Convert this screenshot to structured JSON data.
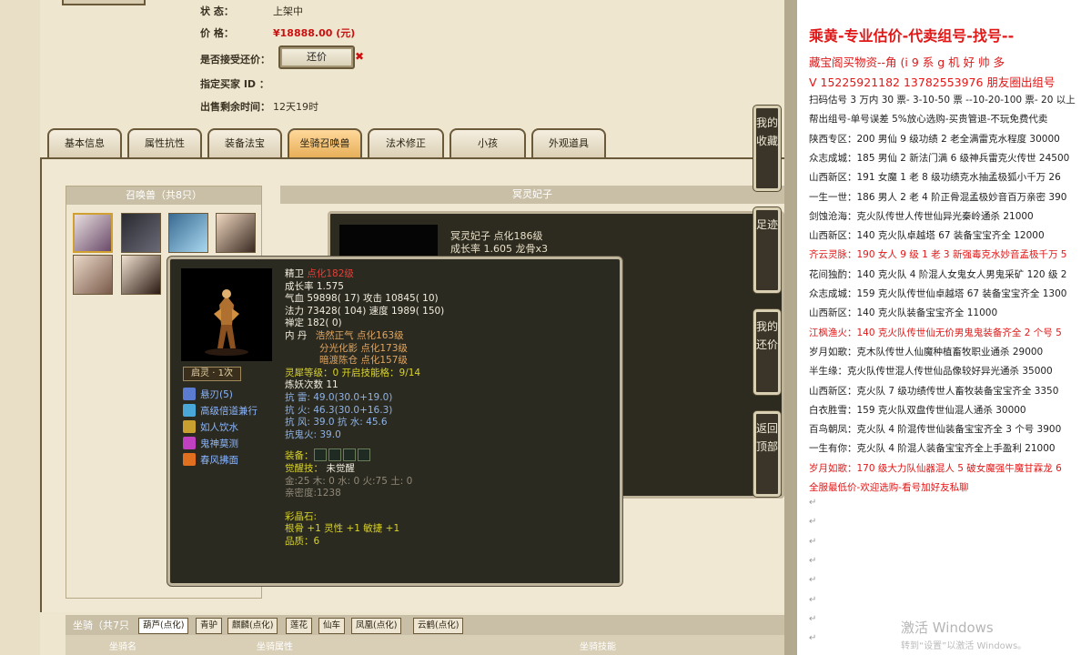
{
  "listing": {
    "status_label": "状      态：",
    "status_value": "上架中",
    "price_label": "价      格：",
    "price_value": "¥18888.00 (元)",
    "haggle_label": "是否接受还价：",
    "haggle_button": "还价",
    "haggle_mark": "✖",
    "buyer_label": "指定买家 ID ：",
    "remaining_label": "出售剩余时间：",
    "remaining_value": "12天19时"
  },
  "tabs": [
    "基本信息",
    "属性抗性",
    "装备法宝",
    "坐骑召唤兽",
    "法术修正",
    "小孩",
    "外观道具"
  ],
  "active_tab": "坐骑召唤兽",
  "summons": {
    "header": "召唤兽（共8只）",
    "detail_header": "冥灵妃子",
    "back_name": "冥灵妃子 点化186级",
    "back_growth": "成长率 1.605 龙骨x3"
  },
  "tooltip": {
    "name": "精卫",
    "level": "点化182级",
    "growth": "成长率 1.575",
    "hp": "气血 59898( 17) 攻击 10845( 10)",
    "mp": "法力 73428( 104) 速度 1989( 150)",
    "zen": "禅定 182( 0)",
    "dan_label": "内   丹",
    "dan1": "浩然正气 点化163级",
    "dan2": "分光化影 点化173级",
    "dan3": "暗渡陈仓 点化157级",
    "spirit": "灵犀等级：0 开启技能格：9/14",
    "refine": "炼妖次数 11",
    "res1": "抗   雷: 49.0(30.0+19.0)",
    "res2": "抗   火: 46.3(30.0+16.3)",
    "res3": "抗   风: 39.0 抗   水: 45.6",
    "res4": "抗鬼火: 39.0",
    "equip_label": "装备：",
    "awaken_label": "觉醒技：",
    "awaken_value": "未觉醒",
    "elements": "金:25 木: 0 水: 0 火:75 土: 0",
    "intimacy": "亲密度:1238",
    "gem_label": "彩晶石:",
    "gem_value": "根骨 +1 灵性 +1 敏捷 +1",
    "quality": "品质：6",
    "rank": "启灵 · 1次",
    "skills": [
      {
        "name": "悬刃(5)",
        "icon": "blade-icon",
        "color": "#5a7bd0"
      },
      {
        "name": "高级倍道兼行",
        "icon": "speed-icon",
        "color": "#4aa8d8"
      },
      {
        "name": "如人饮水",
        "icon": "water-icon",
        "color": "#c8a030"
      },
      {
        "name": "鬼神莫测",
        "icon": "ghost-icon",
        "color": "#c040c0"
      },
      {
        "name": "春风拂面",
        "icon": "fire-icon",
        "color": "#e07020"
      }
    ]
  },
  "mounts": {
    "title": "坐骑（共7只",
    "tabs": [
      "葫芦(点化)",
      "青驴",
      "麒麟(点化)",
      "莲花",
      "仙车",
      "凤凰(点化)",
      "云鹤(点化)"
    ],
    "col_name": "坐骑名",
    "col_attr": "坐骑属性",
    "col_skill": "坐骑技能"
  },
  "side_buttons": [
    "我的收藏",
    "足迹",
    "我的还价",
    "返回顶部"
  ],
  "doc": {
    "title": "乘黄-专业估价-代卖组号-找号--",
    "line_contact1": "藏宝阁买物资--角 (i 9 系  g 机 好 帅 多",
    "line_contact2": "V 15225921182   13782553976 朋友圈出组号",
    "lines": [
      {
        "text": "扫码估号 3 万内 30 票- 3-10-50 票  --10-20-100 票- 20 以上",
        "red": false
      },
      {
        "text": "帮出组号-单号误差 5%放心选购-买贵管退-不玩免费代卖",
        "red": false
      },
      {
        "text": "陕西专区：200 男仙 9 级功绩 2 老全满雷克水程度 30000",
        "red": false
      },
      {
        "text": "众志成城：185 男仙 2 新法门满 6 级神兵雷克火传世 24500",
        "red": false
      },
      {
        "text": "山西新区：191 女魔 1 老 8 级功绩克水抽孟极狐小千万 26",
        "red": false
      },
      {
        "text": "一生一世：186 男人 2 老 4 阶正骨混孟极妙音百万亲密 390",
        "red": false
      },
      {
        "text": "剑蚀沧海：克火队传世人传世仙异光秦岭通杀 21000",
        "red": false
      },
      {
        "text": "山西新区：140 克火队卓越塔 67 装备宝宝齐全 12000",
        "red": false
      },
      {
        "text": "齐云灵脉：190 女人 9 级 1 老 3 新强毒克水妙音孟极千万 5",
        "red": true
      },
      {
        "text": "花间独酌：140 克火队 4 阶混人女鬼女人男鬼采矿 120 级 2",
        "red": false
      },
      {
        "text": "众志成城：159 克火队传世仙卓越塔 67 装备宝宝齐全 1300",
        "red": false
      },
      {
        "text": "山西新区：140 克火队装备宝宝齐全 11000",
        "red": false
      },
      {
        "text": "江枫渔火：140 克火队传世仙无价男鬼鬼装备齐全 2 个号 5",
        "red": true
      },
      {
        "text": "岁月如歌：克木队传世人仙魔种植畜牧职业通杀 29000",
        "red": false
      },
      {
        "text": "半生缘：克火队传世混人传世仙品像较好异光通杀 35000",
        "red": false
      },
      {
        "text": "山西新区：克火队 7 级功绩传世人畜牧装备宝宝齐全 3350",
        "red": false
      },
      {
        "text": "白衣胜雪：159 克火队双盘传世仙混人通杀 30000",
        "red": false
      },
      {
        "text": "百鸟朝凤：克火队 4 阶混传世仙装备宝宝齐全 3 个号 3900",
        "red": false
      },
      {
        "text": "一生有你：克火队 4 阶混人装备宝宝齐全上手盈利 21000",
        "red": false
      },
      {
        "text": "岁月如歌：170 级大力队仙器混人 5 破女魔强牛魔甘霖龙 6",
        "red": true
      },
      {
        "text": "全服最低价-欢迎选购-看号加好友私聊",
        "red": true
      }
    ]
  },
  "watermark": {
    "line1": "激活 Windows",
    "line2": "转到“设置”以激活 Windows。"
  }
}
